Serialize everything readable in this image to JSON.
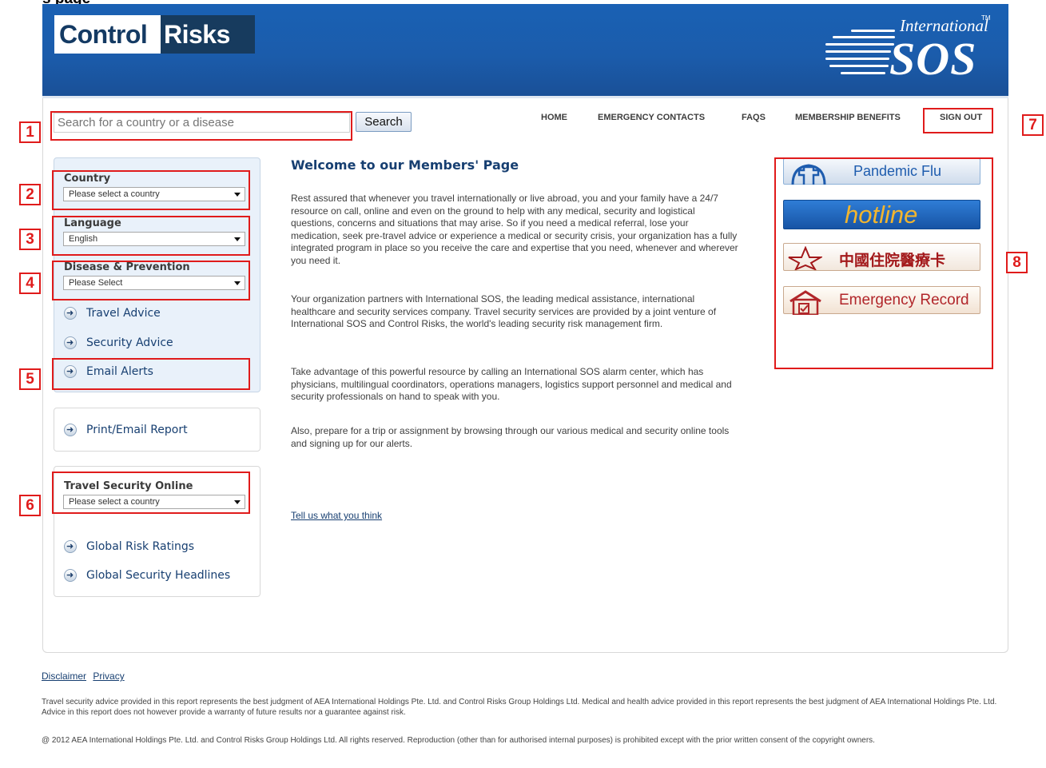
{
  "page": {
    "top_cut_text": "s page"
  },
  "header": {
    "logo_left": {
      "part1": "Control",
      "part2": "Risks"
    },
    "logo_right": {
      "line1": "International",
      "tm": "TM",
      "line2": "SOS"
    }
  },
  "search": {
    "placeholder": "Search for a country or a disease",
    "button_label": "Search"
  },
  "nav": {
    "items": [
      "HOME",
      "EMERGENCY CONTACTS",
      "FAQS",
      "MEMBERSHIP BENEFITS",
      "SIGN OUT"
    ]
  },
  "markers": [
    "1",
    "2",
    "3",
    "4",
    "5",
    "6",
    "7",
    "8"
  ],
  "sidebar": {
    "country": {
      "label": "Country",
      "value": "Please select a country"
    },
    "language": {
      "label": "Language",
      "value": "English"
    },
    "disease": {
      "label": "Disease & Prevention",
      "value": "Please Select"
    },
    "links": [
      "Travel Advice",
      "Security Advice",
      "Email Alerts"
    ],
    "print_link": "Print/Email Report",
    "tso": {
      "label": "Travel Security Online",
      "value": "Please select a country"
    },
    "tso_links": [
      "Global Risk Ratings",
      "Global Security Headlines"
    ]
  },
  "main": {
    "title": "Welcome to our Members' Page",
    "paragraphs": [
      "Rest assured that whenever you travel internationally or live abroad, you and your family have a 24/7 resource on call, online and even on the ground to help with any medical, security and logistical questions, concerns and situations that may arise. So if you need a medical referral, lose your medication, seek pre-travel advice or experience a medical or security crisis, your organization has a fully integrated program in place so you receive the care and expertise that you need, whenever and wherever you need it.",
      "Your organization partners with International SOS, the leading medical assistance, international healthcare and security services company. Travel security services are provided by a joint venture of International SOS and Control Risks, the world's leading security risk management firm.",
      "Take advantage of this powerful resource by calling an International SOS alarm center, which has physicians, multilingual coordinators, operations managers, logistics support personnel and medical and security professionals on hand to speak with you.",
      "Also, prepare for a trip or assignment by browsing through our various medical and security online tools and signing up for our alerts."
    ],
    "feedback_link": "Tell us what you think"
  },
  "banners": {
    "pandemic": "Pandemic Flu",
    "hotline": "hotline",
    "chinese": "中國住院醫療卡",
    "emergency": "Emergency Record"
  },
  "footer": {
    "links": [
      "Disclaimer",
      "Privacy"
    ],
    "disclaimer": "Travel security advice provided in this report represents the best judgment of AEA International Holdings Pte. Ltd. and Control Risks Group Holdings Ltd. Medical and health advice provided in this report represents the best judgment of AEA International Holdings Pte. Ltd. Advice in this report does not however provide a warranty of future results nor a guarantee against risk.",
    "copyright": "@ 2012 AEA International Holdings Pte. Ltd. and Control Risks Group Holdings Ltd. All rights reserved. Reproduction (other than for authorised internal purposes) is prohibited except with the prior written consent of the copyright owners."
  },
  "colors": {
    "header_blue": "#1b5cab",
    "marker_red": "#e01b1b",
    "link_blue": "#173f71",
    "panel_bg": "#e9f1fa"
  }
}
